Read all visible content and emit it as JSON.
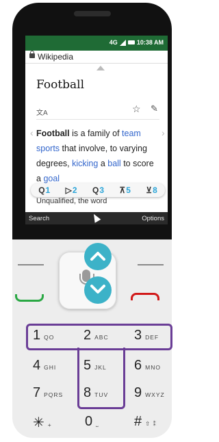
{
  "statusbar": {
    "network": "4G",
    "time": "10:38 AM"
  },
  "app": {
    "title": "Wikipedia"
  },
  "article": {
    "title": "Football",
    "lang_icon": "translate-icon",
    "star_icon": "star-outline-icon",
    "edit_icon": "pencil-icon",
    "para": {
      "bold": "Football",
      "t1": " is a family of ",
      "link1": "team sports",
      "t2": " that involve, to varying degrees, ",
      "link2": "kicking",
      "t3": " a ",
      "link3": "ball",
      "t4": " to score a ",
      "link4": "goal"
    },
    "below_text": "Unqualified, the word"
  },
  "navbar": {
    "items": [
      {
        "icon": "zoom-out-icon",
        "glyph": "Q",
        "num": "1"
      },
      {
        "icon": "cursor-icon",
        "glyph": "▷",
        "num": "2"
      },
      {
        "icon": "zoom-in-icon",
        "glyph": "Q",
        "num": "3"
      },
      {
        "icon": "scroll-top-icon",
        "glyph": "⊼",
        "num": "5"
      },
      {
        "icon": "scroll-bottom-icon",
        "glyph": "⊻",
        "num": "8"
      }
    ]
  },
  "softkeys": {
    "left": "Search",
    "right": "Options"
  },
  "keypad": {
    "k1": {
      "digit": "1",
      "letters": "QO"
    },
    "k2": {
      "digit": "2",
      "letters": "ABC"
    },
    "k3": {
      "digit": "3",
      "letters": "DEF"
    },
    "k4": {
      "digit": "4",
      "letters": "GHI"
    },
    "k5": {
      "digit": "5",
      "letters": "JKL"
    },
    "k6": {
      "digit": "6",
      "letters": "MNO"
    },
    "k7": {
      "digit": "7",
      "letters": "PQRS"
    },
    "k8": {
      "digit": "8",
      "letters": "TUV"
    },
    "k9": {
      "digit": "9",
      "letters": "WXYZ"
    },
    "kstar": {
      "digit": "✳",
      "letters": "+"
    },
    "k0": {
      "digit": "0",
      "letters": "⎵"
    },
    "khash": {
      "digit": "#",
      "letters": "⇧ ⁑"
    }
  },
  "colors": {
    "status_green": "#1f6b35",
    "accent_cyan": "#3cb2c8",
    "outline_purple": "#6a3d96",
    "call_green": "#2aa844",
    "end_red": "#d11919"
  }
}
